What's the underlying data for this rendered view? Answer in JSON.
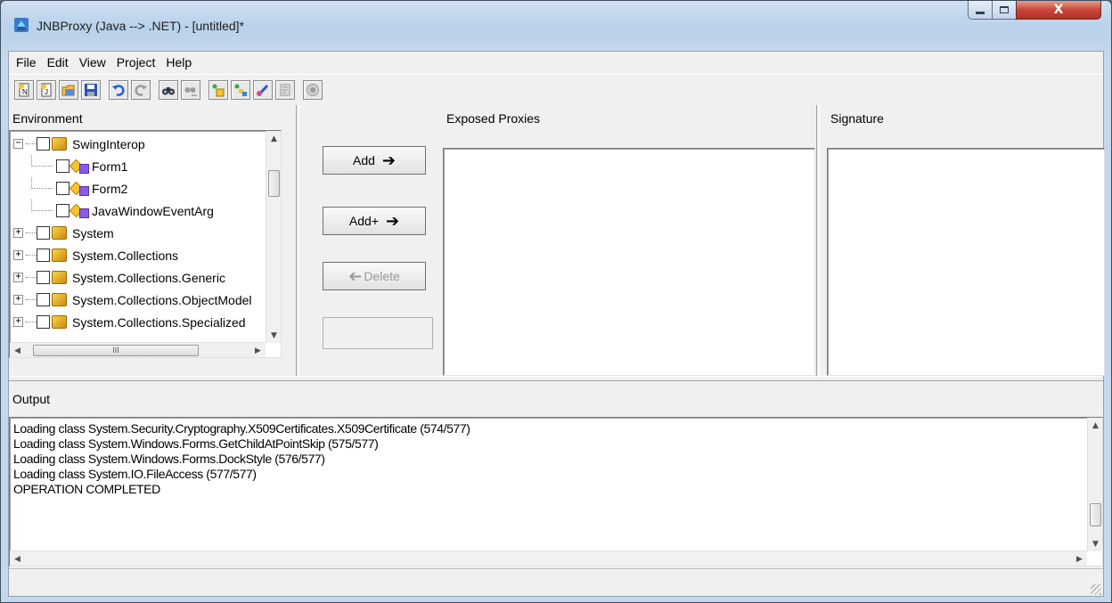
{
  "window": {
    "title": "JNBProxy (Java --> .NET) - [untitled]*",
    "close_glyph": "X"
  },
  "menu": [
    "File",
    "Edit",
    "View",
    "Project",
    "Help"
  ],
  "toolbar_icons": [
    "new-project-icon",
    "new-icon",
    "open-icon",
    "save-icon",
    "undo-icon",
    "redo-icon",
    "find-icon",
    "find-next-icon",
    "add-classpath-icon",
    "add-classes-icon",
    "edit-icon",
    "document-icon",
    "build-icon"
  ],
  "environment": {
    "header": "Environment",
    "tree": [
      {
        "label": "SwingInterop",
        "level": 0,
        "expander": "−",
        "kind": "namespace"
      },
      {
        "label": "Form1",
        "level": 1,
        "kind": "class"
      },
      {
        "label": "Form2",
        "level": 1,
        "kind": "class"
      },
      {
        "label": "JavaWindowEventArg",
        "level": 1,
        "kind": "class"
      },
      {
        "label": "System",
        "level": 0,
        "expander": "+",
        "kind": "namespace"
      },
      {
        "label": "System.Collections",
        "level": 0,
        "expander": "+",
        "kind": "namespace"
      },
      {
        "label": "System.Collections.Generic",
        "level": 0,
        "expander": "+",
        "kind": "namespace"
      },
      {
        "label": "System.Collections.ObjectModel",
        "level": 0,
        "expander": "+",
        "kind": "namespace"
      },
      {
        "label": "System.Collections.Specialized",
        "level": 0,
        "expander": "+",
        "kind": "namespace"
      }
    ],
    "hscroll_thumb_glyph": "III"
  },
  "buttons": {
    "add": "Add",
    "add_plus": "Add+",
    "delete": "Delete"
  },
  "exposed_proxies": {
    "header": "Exposed Proxies"
  },
  "signature": {
    "header": "Signature"
  },
  "output": {
    "header": "Output",
    "lines": [
      "Loading class System.Security.Cryptography.X509Certificates.X509Certificate (574/577)",
      "Loading class System.Windows.Forms.GetChildAtPointSkip (575/577)",
      "Loading class System.Windows.Forms.DockStyle (576/577)",
      "Loading class System.IO.FileAccess (577/577)",
      "OPERATION COMPLETED"
    ]
  }
}
